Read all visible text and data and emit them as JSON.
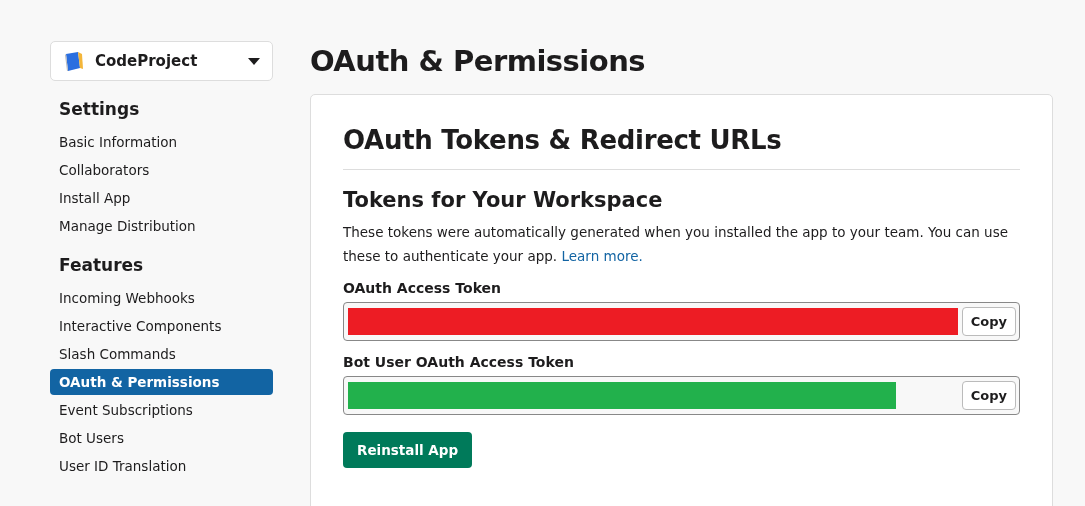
{
  "app_switcher": {
    "name": "CodeProject"
  },
  "sidebar": {
    "sections": [
      {
        "heading": "Settings",
        "items": [
          {
            "label": "Basic Information",
            "selected": false
          },
          {
            "label": "Collaborators",
            "selected": false
          },
          {
            "label": "Install App",
            "selected": false
          },
          {
            "label": "Manage Distribution",
            "selected": false
          }
        ]
      },
      {
        "heading": "Features",
        "items": [
          {
            "label": "Incoming Webhooks",
            "selected": false
          },
          {
            "label": "Interactive Components",
            "selected": false
          },
          {
            "label": "Slash Commands",
            "selected": false
          },
          {
            "label": "OAuth & Permissions",
            "selected": true
          },
          {
            "label": "Event Subscriptions",
            "selected": false
          },
          {
            "label": "Bot Users",
            "selected": false
          },
          {
            "label": "User ID Translation",
            "selected": false
          }
        ]
      }
    ]
  },
  "page_title": "OAuth & Permissions",
  "card": {
    "title": "OAuth Tokens & Redirect URLs",
    "section_title": "Tokens for Your Workspace",
    "description": "These tokens were automatically generated when you installed the app to your team. You can use these to authenticate your app.",
    "link": "Learn more.",
    "tokens": [
      {
        "label": "OAuth Access Token",
        "color": "#ed1c24",
        "button": "Copy"
      },
      {
        "label": "Bot User OAuth Access Token",
        "color": "#22b14c",
        "button": "Copy"
      }
    ],
    "reinstall_button": "Reinstall App"
  }
}
